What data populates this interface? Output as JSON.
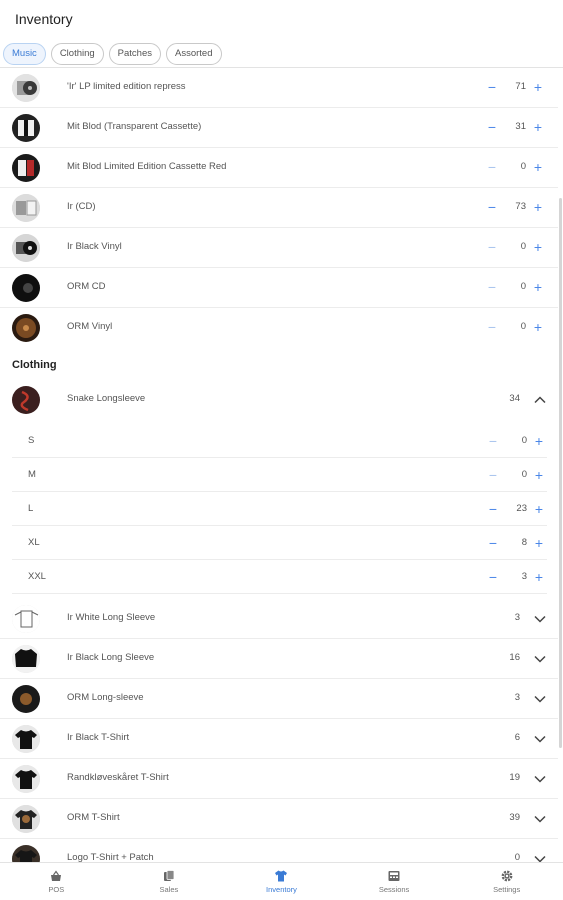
{
  "header": {
    "title": "Inventory",
    "filters": [
      {
        "label": "Music",
        "active": true
      },
      {
        "label": "Clothing",
        "active": false
      },
      {
        "label": "Patches",
        "active": false
      },
      {
        "label": "Assorted",
        "active": false
      }
    ]
  },
  "music_items": [
    {
      "name": "'Ir' LP limited edition repress",
      "qty": "71",
      "thumb": "vinyl-light"
    },
    {
      "name": "Mit Blod (Transparent Cassette)",
      "qty": "31",
      "thumb": "cassette-dark"
    },
    {
      "name": "Mit Blod Limited Edition Cassette Red",
      "qty": "0",
      "thumb": "cassette-red"
    },
    {
      "name": "Ir (CD)",
      "qty": "73",
      "thumb": "cd-light"
    },
    {
      "name": "Ir Black Vinyl",
      "qty": "0",
      "thumb": "vinyl-dark"
    },
    {
      "name": "ORM CD",
      "qty": "0",
      "thumb": "cd-dark"
    },
    {
      "name": "ORM Vinyl",
      "qty": "0",
      "thumb": "vinyl-brown"
    }
  ],
  "clothing": {
    "heading": "Clothing",
    "expanded_item": {
      "name": "Snake Longsleeve",
      "qty": "34",
      "thumb": "snake",
      "sizes": [
        {
          "size": "S",
          "qty": "0"
        },
        {
          "size": "M",
          "qty": "0"
        },
        {
          "size": "L",
          "qty": "23"
        },
        {
          "size": "XL",
          "qty": "8"
        },
        {
          "size": "XXL",
          "qty": "3"
        }
      ]
    },
    "items": [
      {
        "name": "Ir White Long Sleeve",
        "qty": "3",
        "thumb": "shirt-white"
      },
      {
        "name": "Ir Black Long Sleeve",
        "qty": "16",
        "thumb": "shirt-black"
      },
      {
        "name": "ORM Long-sleeve",
        "qty": "3",
        "thumb": "shirt-brown"
      },
      {
        "name": "Ir Black T-Shirt",
        "qty": "6",
        "thumb": "tshirt-black"
      },
      {
        "name": "Randkløveskåret T-Shirt",
        "qty": "19",
        "thumb": "tshirt-black"
      },
      {
        "name": "ORM T-Shirt",
        "qty": "39",
        "thumb": "tshirt-brown"
      },
      {
        "name": "Logo T-Shirt + Patch",
        "qty": "0",
        "thumb": "tshirt-dark"
      }
    ]
  },
  "bottom_nav": [
    {
      "label": "POS",
      "icon": "basket-icon",
      "active": false
    },
    {
      "label": "Sales",
      "icon": "coins-icon",
      "active": false
    },
    {
      "label": "Inventory",
      "icon": "tshirt-icon",
      "active": true
    },
    {
      "label": "Sessions",
      "icon": "register-icon",
      "active": false
    },
    {
      "label": "Settings",
      "icon": "gear-icon",
      "active": false
    }
  ],
  "colors": {
    "accent": "#4a86e8",
    "accent_muted": "#a8c4ee",
    "active_chip_bg": "#eef4fd"
  }
}
